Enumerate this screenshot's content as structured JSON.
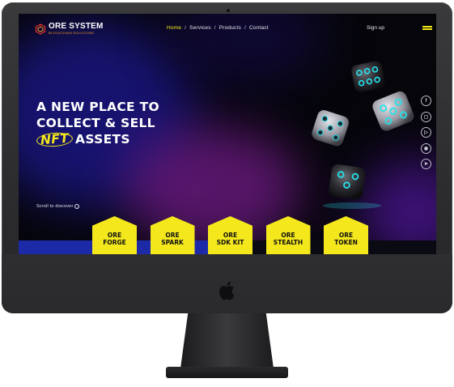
{
  "site": {
    "logo": {
      "title": "ORE SYSTEM",
      "subtitle": "BLOCKCHAIN SOLUTIONS"
    },
    "nav": {
      "items": [
        {
          "label": "Home",
          "active": true
        },
        {
          "label": "Services",
          "active": false
        },
        {
          "label": "Products",
          "active": false
        },
        {
          "label": "Contact",
          "active": false
        }
      ],
      "separator": "/",
      "signup": "Sign up"
    },
    "hero": {
      "line1": "A NEW PLACE TO",
      "line2": "COLLECT & SELL",
      "badge": "NFT",
      "line3_rest": "ASSETS"
    },
    "scroll_hint": "Scroll to discover",
    "social_icons": [
      "facebook-icon",
      "instagram-icon",
      "youtube-icon",
      "camera-icon",
      "telegram-icon"
    ],
    "products": [
      {
        "line1": "ORE",
        "line2": "FORGE"
      },
      {
        "line1": "ORE",
        "line2": "SPARK"
      },
      {
        "line1": "ORE",
        "line2": "SDK KIT"
      },
      {
        "line1": "ORE",
        "line2": "STEALTH"
      },
      {
        "line1": "ORE",
        "line2": "TOKEN"
      }
    ],
    "colors": {
      "accent": "#f4e81c",
      "background": "#05050a",
      "bar_blue": "#1c2aa8",
      "dice_glow": "#27e0e8"
    }
  }
}
